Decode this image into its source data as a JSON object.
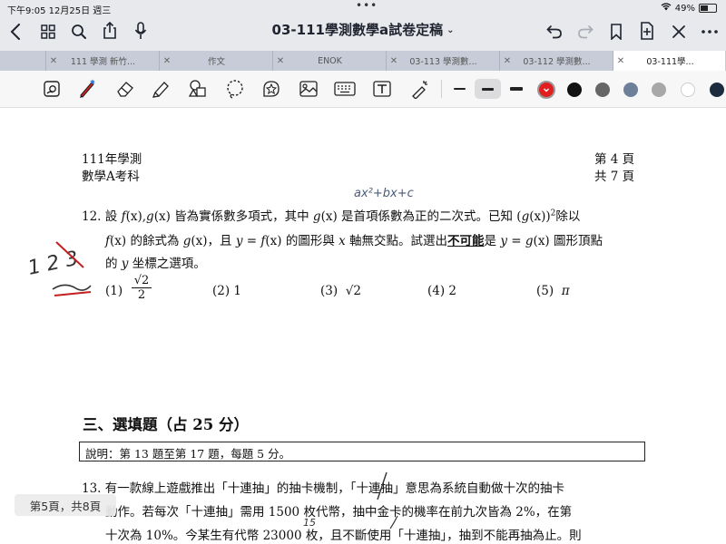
{
  "status_bar": {
    "time": "下午9:05 12月25日 週三",
    "more": "•••",
    "battery": "49%"
  },
  "title_bar": {
    "title": "03-111學測數學a試卷定稿"
  },
  "tabs": [
    {
      "label": "111 學測 新竹..."
    },
    {
      "label": "作文"
    },
    {
      "label": "ENOK"
    },
    {
      "label": "03-113 學測數..."
    },
    {
      "label": "03-112 學測數..."
    },
    {
      "label": "03-111學..."
    }
  ],
  "toolbar": {
    "colors": [
      "#e02020",
      "#111111",
      "#666666",
      "#6d7f99",
      "#a8a8a8",
      "#ffffff",
      "#1c2b3e"
    ]
  },
  "document": {
    "header_left_1": "111年學測",
    "header_left_2": "數學A考科",
    "header_right_1": "第 4 頁",
    "header_right_2": "共 7 頁",
    "q12": {
      "number": "12.",
      "line1_a": "設 ",
      "line1_f": "f",
      "line1_b": "(x),",
      "line1_g": "g",
      "line1_c": "(x) 皆為實係數多項式，其中 ",
      "line1_g2": "g",
      "line1_d": "(x) 是首項係數為正的二次式。已知 (",
      "line1_g3": "g",
      "line1_e": "(x))",
      "line1_sup": "2",
      "line1_f2": "除以",
      "line2_f": "f",
      "line2_a": "(x) 的餘式為 ",
      "line2_g": "g",
      "line2_b": "(x)，且 ",
      "line2_y": "y",
      "line2_c": " = ",
      "line2_f2": "f",
      "line2_d": "(x) 的圖形與 ",
      "line2_x": "x",
      "line2_e": " 軸無交點。試選出",
      "line2_u": "不可能",
      "line2_h": "是 ",
      "line2_y2": "y",
      "line2_i": " = ",
      "line2_g2": "g",
      "line2_j": "(x) 圖形頂點",
      "line3_a": "的 ",
      "line3_y": "y",
      "line3_b": " 坐標之選項。",
      "opt1_label": "(1)",
      "opt1_num": "√2",
      "opt1_den": "2",
      "opt2": "(2) 1",
      "opt3_label": "(3)",
      "opt3_val": "√2",
      "opt4": "(4) 2",
      "opt5_label": "(5)",
      "opt5_val": "π"
    },
    "section3_title": "三、選填題（占 25 分）",
    "section3_note": "說明：第 13 題至第 17 題，每題 5 分。",
    "q13": {
      "line1": "13. 有一款線上遊戲推出「十連抽」的抽卡機制，「十連抽」意思為系統自動做十次的抽卡",
      "line2": "動作。若每次「十連抽」需用 1500 枚代幣，抽中金卡的機率在前九次皆為 2%，在第",
      "line3": "十次為 10%。今某生有代幣 23000 枚，且不斷使用「十連抽」，抽到不能再抽為止。則"
    },
    "handwriting": {
      "note_top": "ax²+bx+c",
      "note_15": "15",
      "note_left": "1 2 3"
    },
    "page_badge": "第5頁，共8頁"
  }
}
